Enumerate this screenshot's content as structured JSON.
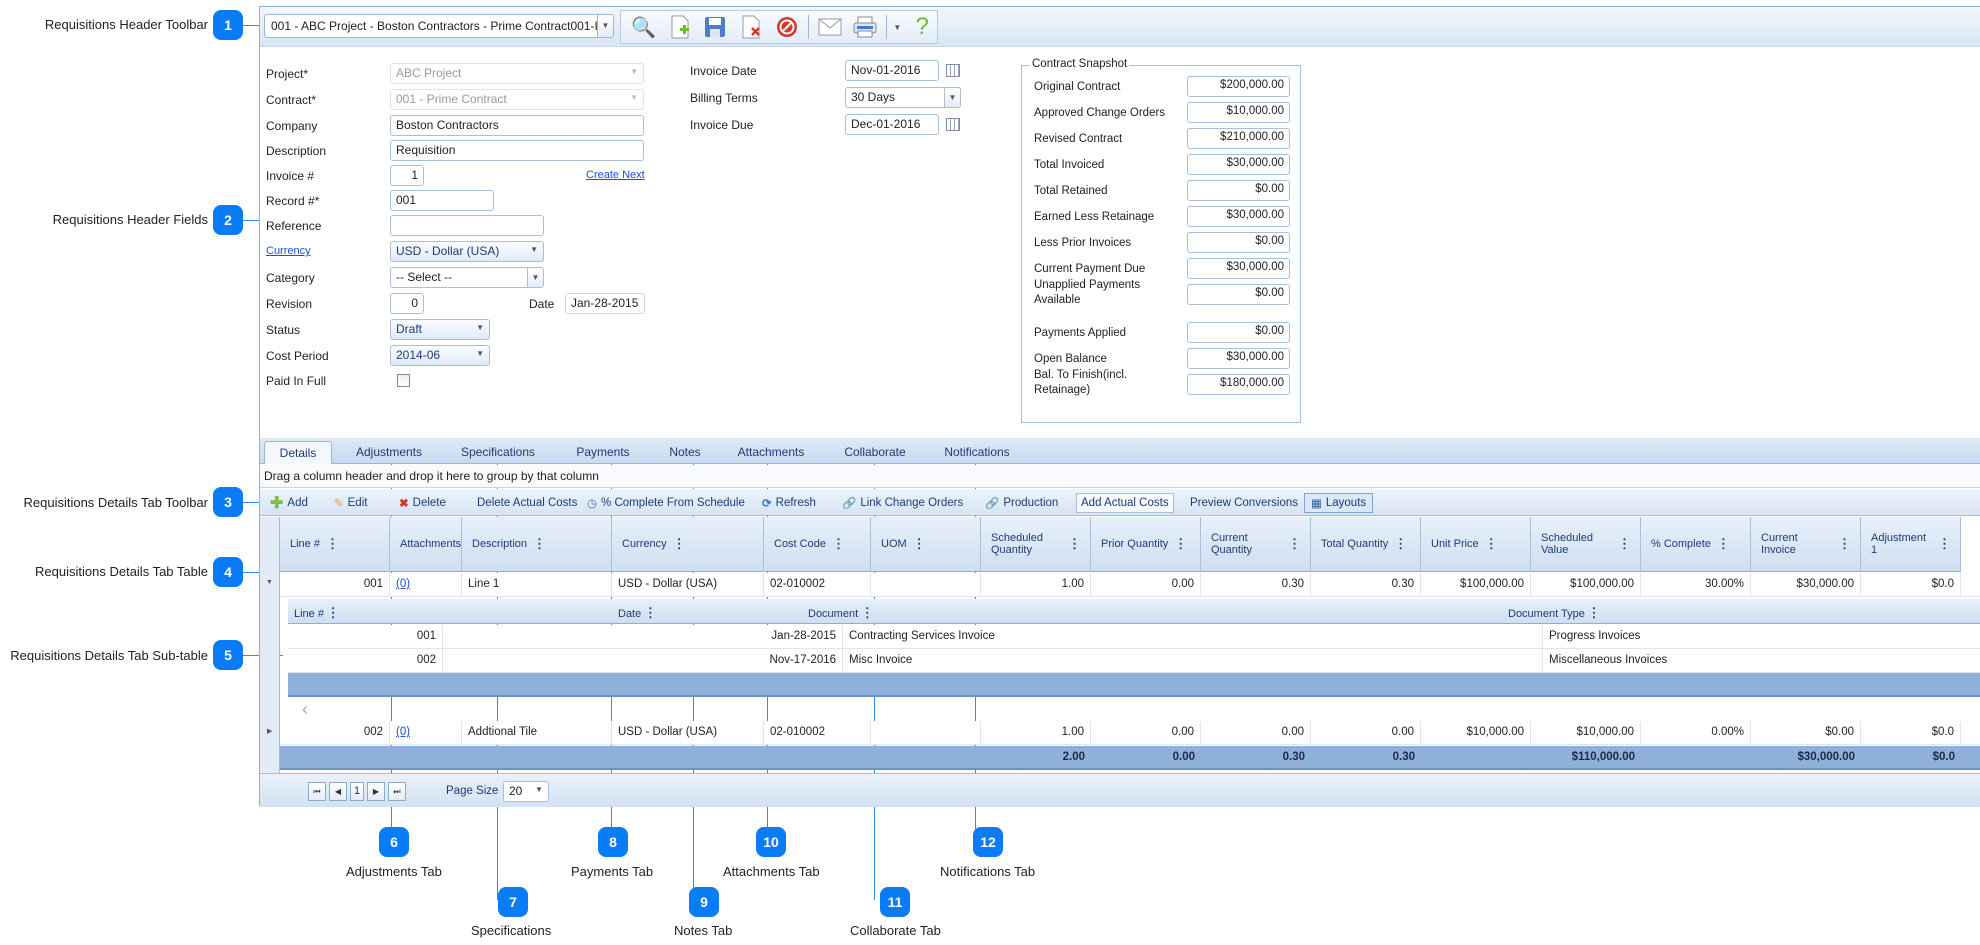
{
  "callouts": [
    {
      "num": "1",
      "label": "Requisitions Header Toolbar"
    },
    {
      "num": "2",
      "label": "Requisitions Header Fields"
    },
    {
      "num": "3",
      "label": "Requisitions Details Tab Toolbar"
    },
    {
      "num": "4",
      "label": "Requisitions Details Tab Table"
    },
    {
      "num": "5",
      "label": "Requisitions Details Tab Sub-table"
    },
    {
      "num": "6",
      "label": "Adjustments Tab"
    },
    {
      "num": "7",
      "label": "Specifications"
    },
    {
      "num": "8",
      "label": "Payments Tab"
    },
    {
      "num": "9",
      "label": "Notes Tab"
    },
    {
      "num": "10",
      "label": "Attachments Tab"
    },
    {
      "num": "11",
      "label": "Collaborate Tab"
    },
    {
      "num": "12",
      "label": "Notifications Tab"
    }
  ],
  "header_toolbar": {
    "record_select": "001 - ABC Project - Boston Contractors - Prime Contract001-I",
    "icons": [
      "search-icon",
      "new-document-icon",
      "save-icon",
      "delete-document-icon",
      "cancel-icon",
      "email-icon",
      "print-icon",
      "help-icon"
    ]
  },
  "form": {
    "project": {
      "label": "Project*",
      "value": "ABC Project"
    },
    "contract": {
      "label": "Contract*",
      "value": "001 - Prime Contract"
    },
    "company": {
      "label": "Company",
      "value": "Boston Contractors"
    },
    "description": {
      "label": "Description",
      "value": "Requisition"
    },
    "invoice_no": {
      "label": "Invoice #",
      "value": "1",
      "create_next": "Create Next"
    },
    "record_no": {
      "label": "Record #*",
      "value": "001"
    },
    "reference": {
      "label": "Reference",
      "value": ""
    },
    "currency": {
      "label": "Currency",
      "value": "USD - Dollar (USA)"
    },
    "category": {
      "label": "Category",
      "value": "-- Select --"
    },
    "revision": {
      "label": "Revision",
      "value": "0",
      "date_label": "Date",
      "date_value": "Jan-28-2015"
    },
    "status": {
      "label": "Status",
      "value": "Draft"
    },
    "cost_period": {
      "label": "Cost Period",
      "value": "2014-06"
    },
    "paid_in_full": {
      "label": "Paid In Full",
      "checked": false
    },
    "invoice_date": {
      "label": "Invoice Date",
      "value": "Nov-01-2016"
    },
    "billing_terms": {
      "label": "Billing Terms",
      "value": "30 Days"
    },
    "invoice_due": {
      "label": "Invoice Due",
      "value": "Dec-01-2016"
    }
  },
  "snapshot": {
    "title": "Contract Snapshot",
    "rows": [
      {
        "label": "Original Contract",
        "value": "$200,000.00"
      },
      {
        "label": "Approved Change Orders",
        "value": "$10,000.00"
      },
      {
        "label": "Revised Contract",
        "value": "$210,000.00"
      },
      {
        "label": "Total Invoiced",
        "value": "$30,000.00"
      },
      {
        "label": "Total Retained",
        "value": "$0.00"
      },
      {
        "label": "Earned Less Retainage",
        "value": "$30,000.00"
      },
      {
        "label": "Less Prior Invoices",
        "value": "$0.00"
      },
      {
        "label": "Current Payment Due",
        "value": "$30,000.00"
      },
      {
        "label": "Unapplied Payments Available",
        "value": "$0.00"
      },
      {
        "label": "Payments Applied",
        "value": "$0.00"
      },
      {
        "label": "Open Balance",
        "value": "$30,000.00"
      },
      {
        "label": "Bal. To Finish(incl. Retainage)",
        "value": "$180,000.00"
      }
    ]
  },
  "tabs": [
    "Details",
    "Adjustments",
    "Specifications",
    "Payments",
    "Notes",
    "Attachments",
    "Collaborate",
    "Notifications"
  ],
  "group_hint": "Drag a column header and drop it here to group by that column",
  "grid_toolbar": {
    "add": "Add",
    "edit": "Edit",
    "delete": "Delete",
    "delete_actual": "Delete Actual Costs",
    "pct_complete": "% Complete From Schedule",
    "refresh": "Refresh",
    "link_co": "Link Change Orders",
    "production": "Production",
    "add_actual": "Add Actual Costs",
    "preview": "Preview Conversions",
    "layouts": "Layouts"
  },
  "grid": {
    "columns": [
      "Line #",
      "Attachments",
      "Description",
      "Currency",
      "Cost Code",
      "UOM",
      "Scheduled Quantity",
      "Prior Quantity",
      "Current Quantity",
      "Total Quantity",
      "Unit Price",
      "Scheduled Value",
      "% Complete",
      "Current Invoice",
      "Adjustment 1"
    ],
    "rows": [
      [
        "001",
        "(0)",
        "Line 1",
        "USD - Dollar (USA)",
        "02-010002",
        "",
        "1.00",
        "0.00",
        "0.30",
        "0.30",
        "$100,000.00",
        "$100,000.00",
        "30.00%",
        "$30,000.00",
        "$0.0"
      ],
      [
        "002",
        "(0)",
        "Addtional Tile",
        "USD - Dollar (USA)",
        "02-010002",
        "",
        "1.00",
        "0.00",
        "0.00",
        "0.00",
        "$10,000.00",
        "$10,000.00",
        "0.00%",
        "$0.00",
        "$0.0"
      ]
    ],
    "totals": [
      "",
      "",
      "",
      "",
      "",
      "",
      "2.00",
      "0.00",
      "0.30",
      "0.30",
      "",
      "$110,000.00",
      "",
      "$30,000.00",
      "$0.0"
    ],
    "subtable": {
      "columns": [
        "Line #",
        "Date",
        "Document",
        "Document Type"
      ],
      "rows": [
        [
          "001",
          "Jan-28-2015",
          "Contracting Services Invoice",
          "Progress Invoices"
        ],
        [
          "002",
          "Nov-17-2016",
          "Misc Invoice",
          "Miscellaneous Invoices"
        ]
      ]
    }
  },
  "pager": {
    "page": "1",
    "page_size_label": "Page Size",
    "page_size": "20"
  }
}
